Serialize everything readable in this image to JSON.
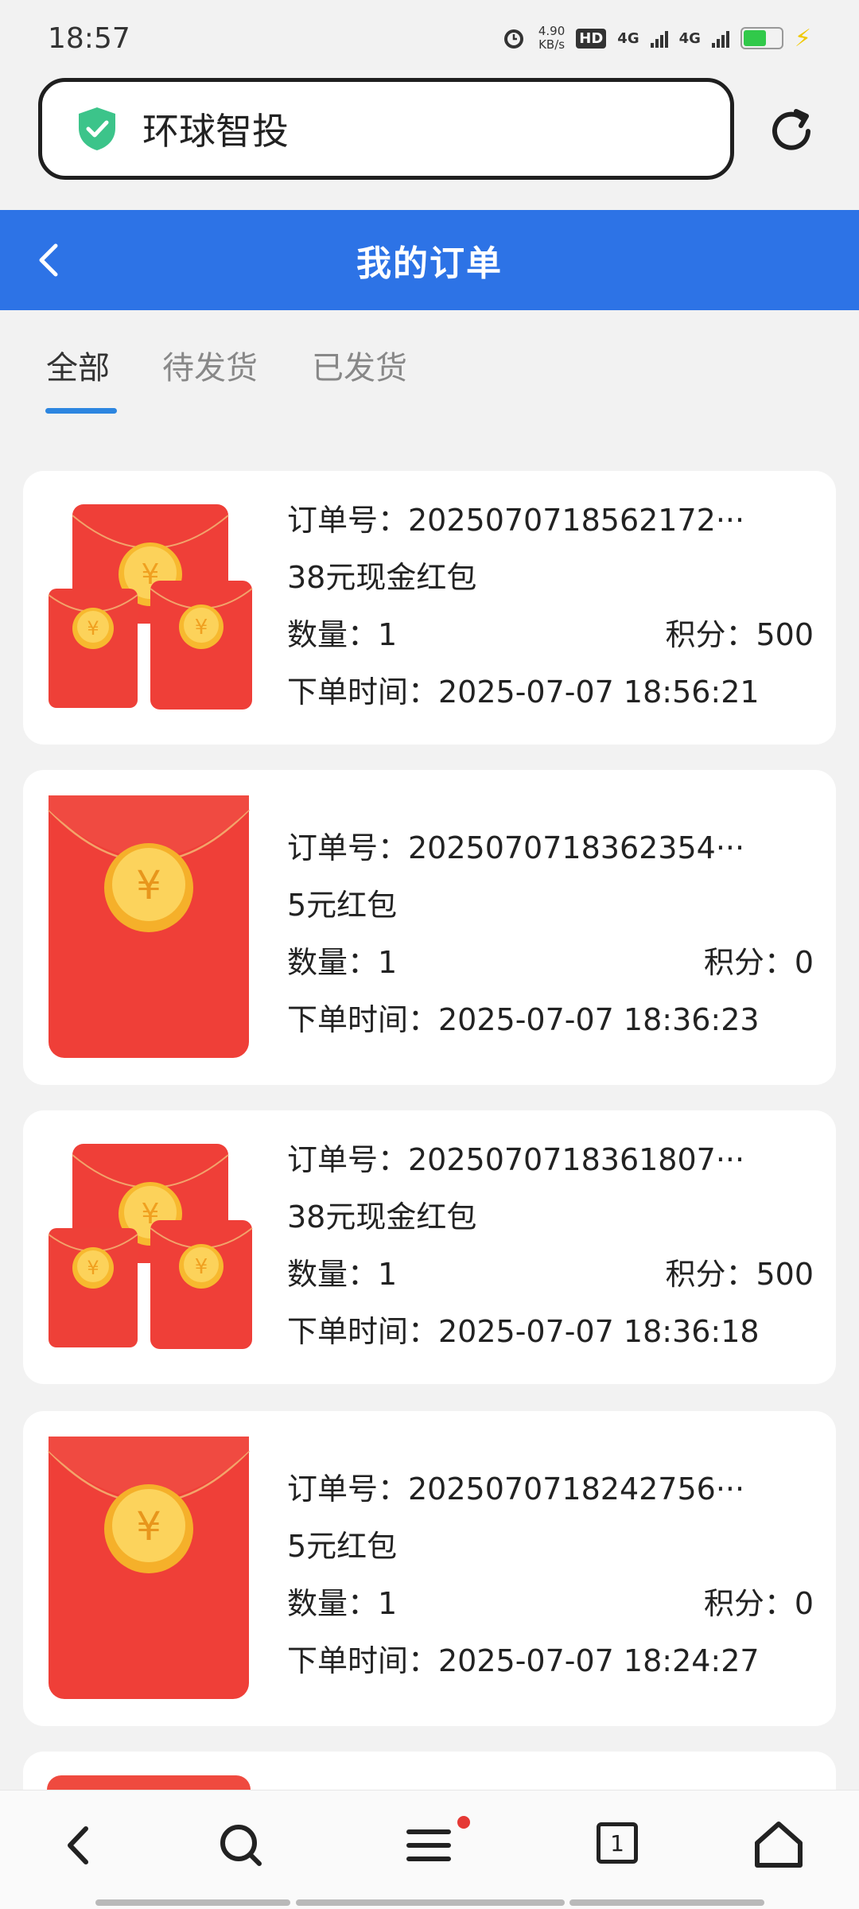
{
  "status_bar": {
    "time": "18:57",
    "net_speed_value": "4.90",
    "net_speed_unit": "KB/s",
    "hd_label": "HD",
    "sim1": "4G",
    "sim2": "4G",
    "battery_level": 0.6
  },
  "browser": {
    "site_name": "环球智投",
    "icons": [
      "shield-check-icon",
      "refresh-icon"
    ]
  },
  "header": {
    "title": "我的订单"
  },
  "tabs": [
    {
      "label": "全部",
      "active": true
    },
    {
      "label": "待发货",
      "active": false
    },
    {
      "label": "已发货",
      "active": false
    }
  ],
  "orders": [
    {
      "order_no": "订单号：2025070718562172···",
      "product": "38元现金红包",
      "quantity": "数量：1",
      "points": "积分：500",
      "time": "下单时间：2025-07-07 18:56:21",
      "image": "red-envelope-bundle"
    },
    {
      "order_no": "订单号：2025070718362354···",
      "product": "5元红包",
      "quantity": "数量：1",
      "points": "积分：0",
      "time": "下单时间：2025-07-07 18:36:23",
      "image": "red-envelope-single"
    },
    {
      "order_no": "订单号：2025070718361807···",
      "product": "38元现金红包",
      "quantity": "数量：1",
      "points": "积分：500",
      "time": "下单时间：2025-07-07 18:36:18",
      "image": "red-envelope-bundle"
    },
    {
      "order_no": "订单号：2025070718242756···",
      "product": "5元红包",
      "quantity": "数量：1",
      "points": "积分：0",
      "time": "下单时间：2025-07-07 18:24:27",
      "image": "red-envelope-single"
    }
  ],
  "bottom_nav": {
    "tab_count": "1",
    "icons": [
      "back-icon",
      "search-icon",
      "menu-icon",
      "tabs-icon",
      "home-icon"
    ]
  },
  "colors": {
    "header_bg": "#2d73e6",
    "tab_underline": "#2d86e0",
    "envelope_red": "#ef3b3b",
    "coin_gold": "#f8c53a"
  }
}
